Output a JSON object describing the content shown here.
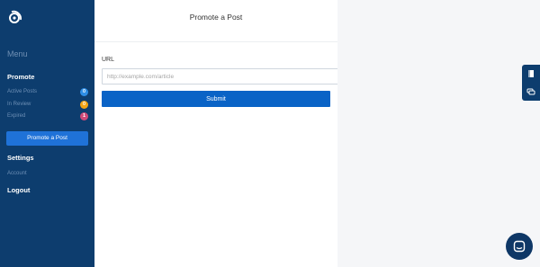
{
  "sidebar": {
    "menu_title": "Menu",
    "promote_title": "Promote",
    "items": [
      {
        "label": "Active Posts",
        "count": "0",
        "color": "#2e8ee6"
      },
      {
        "label": "In Review",
        "count": "0",
        "color": "#f2a414"
      },
      {
        "label": "Expired",
        "count": "1",
        "color": "#d04a78"
      }
    ],
    "promote_button": "Promote a Post",
    "settings_title": "Settings",
    "account_label": "Account",
    "logout_label": "Logout"
  },
  "main": {
    "title": "Promote a Post",
    "url_label": "URL",
    "url_placeholder": "http://example.com/article",
    "url_value": "",
    "submit_label": "Submit"
  },
  "side_tabs": {
    "icons": [
      "book-icon",
      "chat-bubbles-icon"
    ]
  },
  "chat_widget": {
    "icon": "chat-icon"
  },
  "colors": {
    "sidebar_bg": "#0d3d6e",
    "accent": "#0a63c6"
  }
}
